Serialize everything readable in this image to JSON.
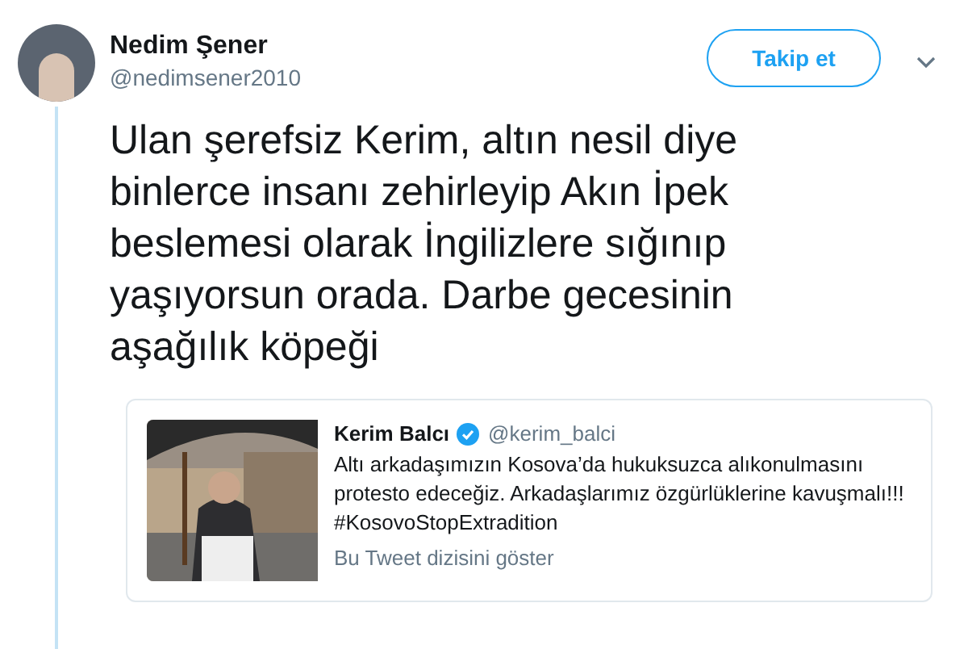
{
  "tweet": {
    "author": {
      "name": "Nedim Şener",
      "handle": "@nedimsener2010"
    },
    "follow_button": "Takip et",
    "text": "Ulan şerefsiz Kerim, altın nesil diye binlerce insanı zehirleyip Akın İpek beslemesi olarak İngilizlere sığınıp yaşıyorsun orada. Darbe gecesinin aşağılık köpeği",
    "quoted_tweet": {
      "author": {
        "name": "Kerim Balcı",
        "verified": true,
        "handle": "@kerim_balci"
      },
      "text": "Altı arkadaşımızın Kosova’da hukuksuzca alıkonulmasını protesto edeceğiz. Arkadaşlarımız özgürlüklerine kavuşmalı!!! #KosovoStopExtradition",
      "show_thread": "Bu Tweet dizisini göster"
    }
  }
}
